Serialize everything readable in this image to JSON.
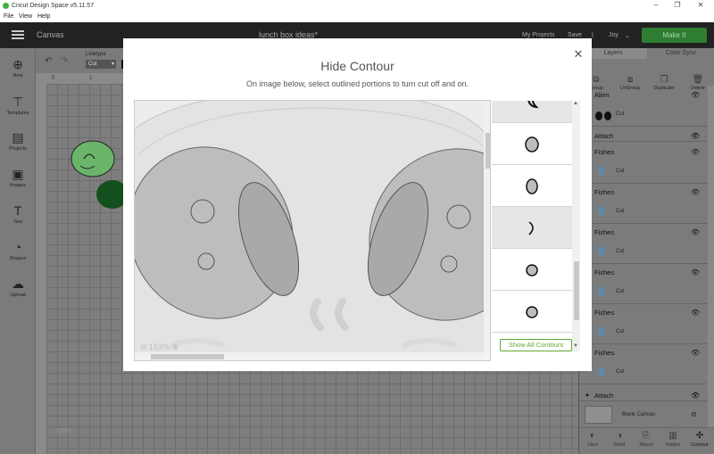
{
  "window": {
    "title": "Cricut Design Space  v5.11.57",
    "controls": [
      "–",
      "❐",
      "✕"
    ]
  },
  "menu": [
    "File",
    "View",
    "Help"
  ],
  "header": {
    "canvas_label": "Canvas",
    "project_name": "lunch box ideas*",
    "my_projects": "My Projects",
    "save": "Save",
    "separator": "|",
    "user": "Joy",
    "make_it": "Make It"
  },
  "toolbar": {
    "linetype_label": "Linetype",
    "linetype_value": "Cut"
  },
  "left_tools": [
    {
      "label": "New",
      "icon": "⊕"
    },
    {
      "label": "Templates",
      "icon": "👕"
    },
    {
      "label": "Projects",
      "icon": "▤"
    },
    {
      "label": "Images",
      "icon": "▣"
    },
    {
      "label": "Text",
      "icon": "T"
    },
    {
      "label": "Shapes",
      "icon": "◔"
    },
    {
      "label": "Upload",
      "icon": "☁"
    }
  ],
  "ruler": {
    "marks": [
      "0",
      "1"
    ]
  },
  "canvas_zoom": "100%",
  "right_panel": {
    "tabs": [
      "Layers",
      "Color Sync"
    ],
    "tools": [
      "Group",
      "UnGroup",
      "Duplicate",
      "Delete"
    ],
    "groups": [
      {
        "title": "Alien",
        "sub": "Cut",
        "kind": "alien"
      },
      {
        "title": "Attach",
        "kind": "attach"
      },
      {
        "title": "Fishes",
        "sub": "Cut",
        "kind": "fish"
      },
      {
        "title": "Fishes",
        "sub": "Cut",
        "kind": "fish"
      },
      {
        "title": "Fishes",
        "sub": "Cut",
        "kind": "fish"
      },
      {
        "title": "Fishes",
        "sub": "Cut",
        "kind": "fish"
      },
      {
        "title": "Fishes",
        "sub": "Cut",
        "kind": "fish"
      },
      {
        "title": "Fishes",
        "sub": "Cut",
        "kind": "fish"
      },
      {
        "title": "Attach",
        "kind": "attach"
      }
    ],
    "blank_canvas": "Blank Canvas",
    "bottom_tools": [
      "Slice",
      "Weld",
      "Attach",
      "Flatten",
      "Contour"
    ]
  },
  "modal": {
    "title": "Hide Contour",
    "subtitle": "On image below, select outlined portions to turn cut off and on.",
    "zoom": "153%",
    "show_all_button": "Show All Contours",
    "contours": [
      {
        "shape": "curl",
        "state": "off"
      },
      {
        "shape": "circle",
        "state": "on"
      },
      {
        "shape": "oval",
        "state": "on"
      },
      {
        "shape": "crescent",
        "state": "off"
      },
      {
        "shape": "small-circle",
        "state": "on"
      },
      {
        "shape": "small-circle",
        "state": "on"
      }
    ]
  }
}
